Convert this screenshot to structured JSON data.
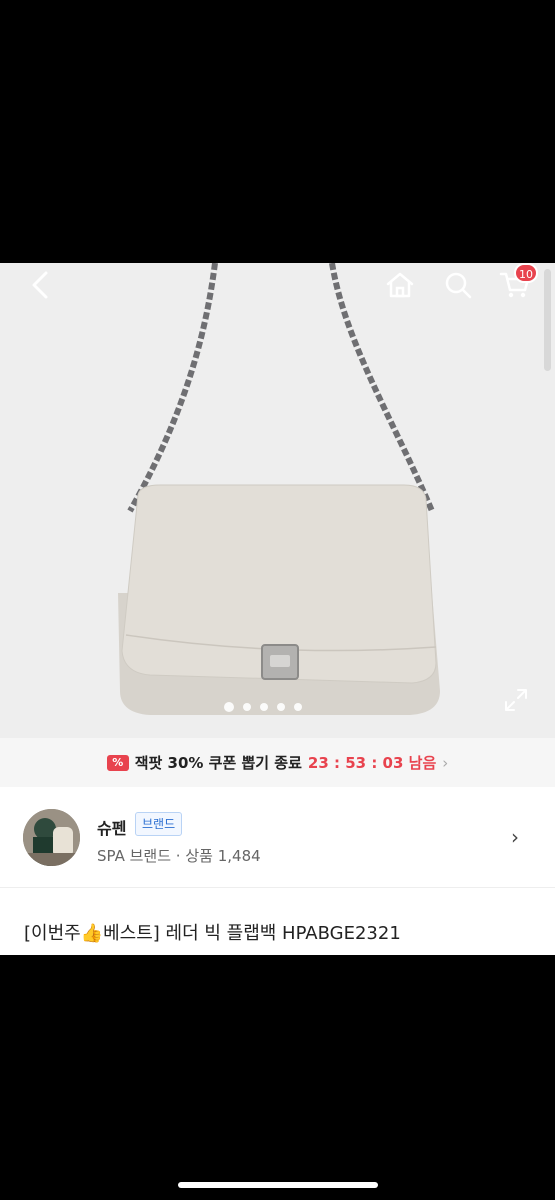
{
  "header": {
    "cart_badge": "10",
    "icons": [
      "chevron-left-icon",
      "home-icon",
      "search-icon",
      "cart-icon"
    ]
  },
  "gallery": {
    "image_count": 5,
    "active_index": 0
  },
  "promo": {
    "coupon_glyph": "%",
    "text": "잭팟 30% 쿠폰 뽑기 종료",
    "timer": "23 : 53 : 03 남음",
    "chevron": "›"
  },
  "shop": {
    "name": "슈펜",
    "badge": "브랜드",
    "meta": "SPA 브랜드 · 상품 1,484",
    "chevron": "›"
  },
  "product": {
    "title": "[이번주👍베스트] 레더 빅 플랩백 HPABGE2321"
  },
  "colors": {
    "accent_red": "#e8434e",
    "brand_blue": "#2c6fd1",
    "hero_bg": "#eeeeee"
  }
}
